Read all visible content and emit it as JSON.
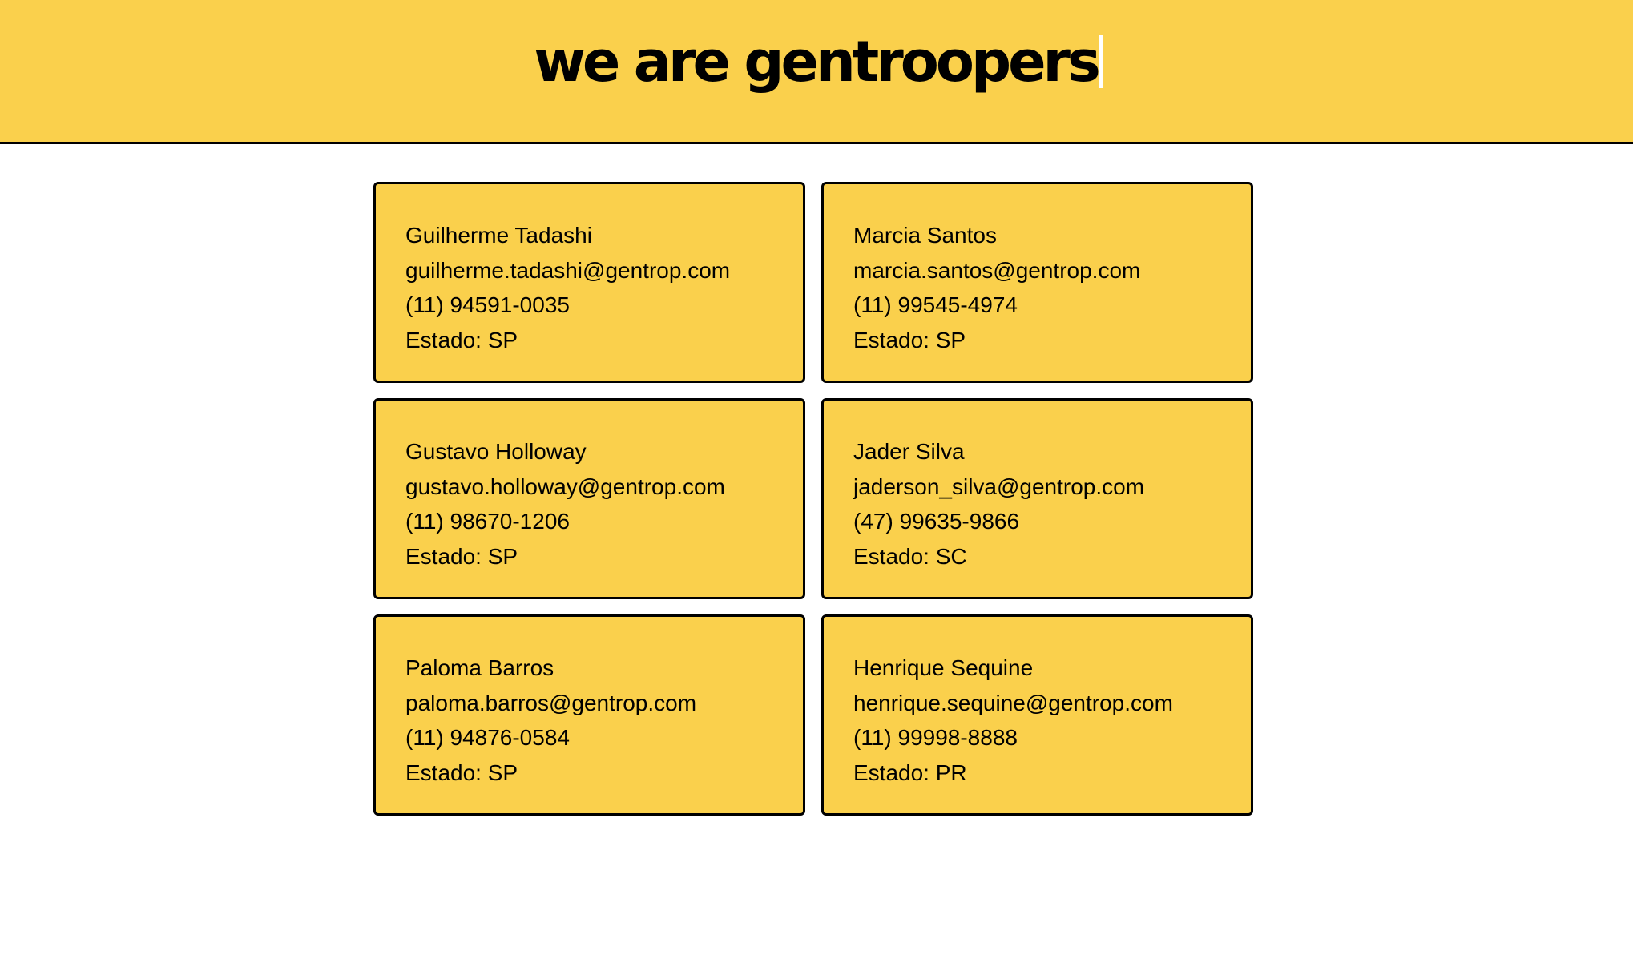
{
  "header": {
    "title": "we are gentroopers"
  },
  "contacts": [
    {
      "name": "Guilherme Tadashi",
      "email": "guilherme.tadashi@gentrop.com",
      "phone": "(11) 94591-0035",
      "state": "Estado: SP"
    },
    {
      "name": "Marcia Santos",
      "email": "marcia.santos@gentrop.com",
      "phone": "(11) 99545-4974",
      "state": "Estado: SP"
    },
    {
      "name": "Gustavo Holloway",
      "email": "gustavo.holloway@gentrop.com",
      "phone": "(11) 98670-1206",
      "state": "Estado: SP"
    },
    {
      "name": "Jader Silva",
      "email": "jaderson_silva@gentrop.com",
      "phone": "(47) 99635-9866",
      "state": "Estado: SC"
    },
    {
      "name": "Paloma Barros",
      "email": "paloma.barros@gentrop.com",
      "phone": "(11) 94876-0584",
      "state": "Estado: SP"
    },
    {
      "name": "Henrique Sequine",
      "email": "henrique.sequine@gentrop.com",
      "phone": "(11) 99998-8888",
      "state": "Estado: PR"
    }
  ],
  "colors": {
    "accent": "#fad04c",
    "border": "#000000",
    "background": "#ffffff"
  }
}
